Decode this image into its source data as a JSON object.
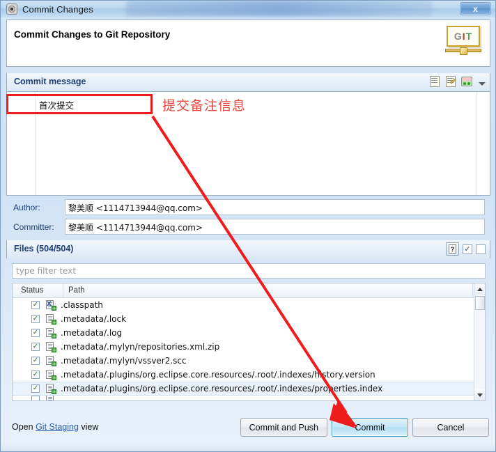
{
  "window": {
    "title": "Commit Changes",
    "title_icon": "gear-icon",
    "close_label": "x"
  },
  "header": {
    "title": "Commit Changes to Git Repository",
    "logo": {
      "g": "G",
      "i": "I",
      "t": "T"
    }
  },
  "commit_message": {
    "section_title": "Commit message",
    "value": "首次提交",
    "tools": [
      {
        "name": "amend-commit-icon",
        "glyph": ""
      },
      {
        "name": "signed-off-icon",
        "glyph": ""
      },
      {
        "name": "add-change-id-icon",
        "glyph": ""
      },
      {
        "name": "chevron-down-icon",
        "glyph": ""
      }
    ]
  },
  "annotation": {
    "note": "提交备注信息",
    "color": "#e8453c",
    "box_color": "#ee1c1c"
  },
  "author": {
    "label": "Author:",
    "value": "黎美顺 <1114713944@qq.com>"
  },
  "committer": {
    "label": "Committer:",
    "value": "黎美顺 <1114713944@qq.com>"
  },
  "files": {
    "section_title": "Files (504/504)",
    "filter_placeholder": "type filter text",
    "filter_value": "",
    "tools": [
      {
        "name": "show-untracked-button",
        "glyph": "?"
      },
      {
        "name": "select-all-checkbox",
        "glyph": "✓"
      },
      {
        "name": "deselect-all-checkbox",
        "glyph": ""
      }
    ],
    "columns": [
      "Status",
      "Path"
    ],
    "rows": [
      {
        "checked": true,
        "icon": "xml-file-added-icon",
        "icon_letter": "X",
        "path": ".classpath",
        "selected": false
      },
      {
        "checked": true,
        "icon": "file-added-icon",
        "icon_letter": "",
        "path": ".metadata/.lock",
        "selected": false
      },
      {
        "checked": true,
        "icon": "file-added-icon",
        "icon_letter": "",
        "path": ".metadata/.log",
        "selected": false
      },
      {
        "checked": true,
        "icon": "file-added-icon",
        "icon_letter": "",
        "path": ".metadata/.mylyn/repositories.xml.zip",
        "selected": false
      },
      {
        "checked": true,
        "icon": "file-added-icon",
        "icon_letter": "",
        "path": ".metadata/.mylyn/vssver2.scc",
        "selected": false
      },
      {
        "checked": true,
        "icon": "file-added-icon",
        "icon_letter": "",
        "path": ".metadata/.plugins/org.eclipse.core.resources/.root/.indexes/history.version",
        "selected": false
      },
      {
        "checked": true,
        "icon": "file-added-icon",
        "icon_letter": "",
        "path": ".metadata/.plugins/org.eclipse.core.resources/.root/.indexes/properties.index",
        "selected": true
      }
    ]
  },
  "footer": {
    "open_prefix": "Open ",
    "link": "Git Staging",
    "open_suffix": " view",
    "buttons": {
      "commit_and_push": "Commit and Push",
      "commit": "Commit",
      "cancel": "Cancel"
    }
  }
}
